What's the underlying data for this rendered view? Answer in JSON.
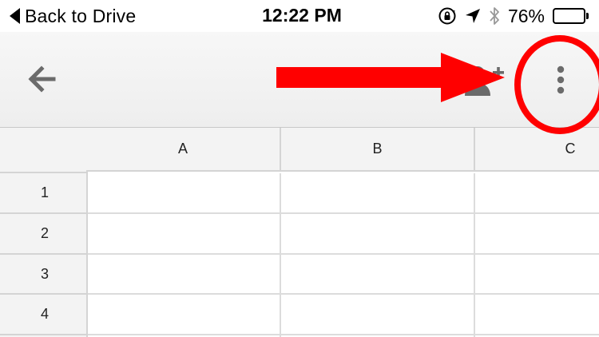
{
  "status_bar": {
    "back_label": "Back to Drive",
    "time": "12:22 PM",
    "battery_percent": "76%",
    "battery_level": 0.76,
    "icons": [
      "back-triangle-icon",
      "orientation-lock-icon",
      "location-arrow-icon",
      "bluetooth-icon",
      "battery-icon"
    ]
  },
  "toolbar": {
    "icons": [
      "back-arrow-icon",
      "share-add-person-icon",
      "more-options-icon"
    ],
    "icon_color": "#6b6b6b"
  },
  "annotation": {
    "color": "#ff0000",
    "shapes": [
      "arrow",
      "circle"
    ]
  },
  "sheet": {
    "columns": [
      "A",
      "B",
      "C"
    ],
    "rows": [
      "1",
      "2",
      "3",
      "4"
    ],
    "header_bg": "#f3f3f3"
  }
}
